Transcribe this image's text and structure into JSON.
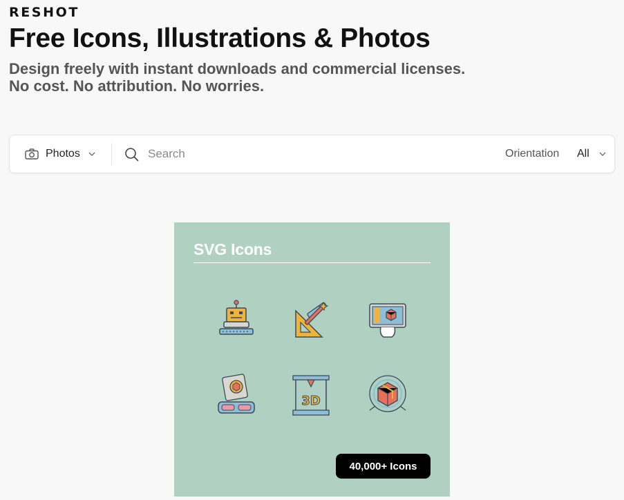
{
  "brand": {
    "logo": "RESHOT"
  },
  "hero": {
    "title": "Free Icons, Illustrations & Photos",
    "subtitle_line1": "Design freely with instant downloads and commercial licenses.",
    "subtitle_line2": "No cost. No attribution. No worries."
  },
  "search": {
    "type_selected": "Photos",
    "type_icon": "camera-icon",
    "placeholder": "Search",
    "value": "",
    "orientation_label": "Orientation",
    "orientation_selected": "All"
  },
  "promo": {
    "title": "SVG Icons",
    "badge": "40,000+ Icons",
    "background": "#b0d0c2",
    "icons": [
      "robot-icon",
      "drafting-tools-icon",
      "computer-3d-model-icon",
      "vr-headset-icon",
      "3d-printer-icon",
      "3d-cube-globe-icon"
    ],
    "icon_3d_text": "3D"
  },
  "colors": {
    "accent": "#111111",
    "muted": "#555555",
    "badge_bg": "#000000"
  }
}
